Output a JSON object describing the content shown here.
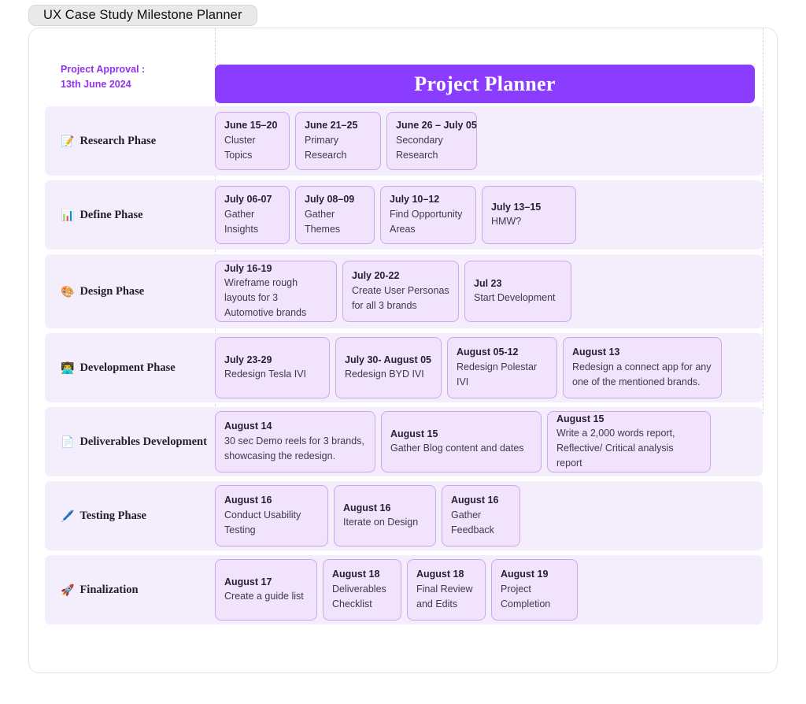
{
  "window": {
    "title": "UX Case Study Milestone Planner"
  },
  "header": {
    "approval_label": "Project Approval :",
    "approval_date": "13th June 2024",
    "banner_title": "Project Planner"
  },
  "colors": {
    "banner_bg": "#8b3dff",
    "accent_purple": "#9333ea",
    "row_bg": "#f4eefc",
    "card_bg": "#f1e3fb",
    "card_border": "#cda6ef",
    "guide_dash": "#dcc6f3"
  },
  "rows": [
    {
      "icon": "memo-icon",
      "icon_glyph": "📝",
      "label": "Research Phase",
      "cards": [
        {
          "date": "June 15–20",
          "desc": "Cluster Topics"
        },
        {
          "date": "June 21–25",
          "desc": "Primary Research"
        },
        {
          "date": "June 26 – July 05",
          "desc": "Secondary Research"
        }
      ]
    },
    {
      "icon": "bar-chart-icon",
      "icon_glyph": "📊",
      "label": "Define  Phase",
      "cards": [
        {
          "date": "July 06-07",
          "desc": "Gather Insights"
        },
        {
          "date": "July 08–09",
          "desc": "Gather Themes"
        },
        {
          "date": "July 10–12",
          "desc": "Find Opportunity Areas"
        },
        {
          "date": "July 13–15",
          "desc": "HMW?"
        }
      ]
    },
    {
      "icon": "palette-icon",
      "icon_glyph": "🎨",
      "label": "Design Phase",
      "cards": [
        {
          "date": "July 16-19",
          "desc": "Wireframe rough layouts for 3 Automotive brands"
        },
        {
          "date": "July 20-22",
          "desc": "Create User Personas for all 3 brands"
        },
        {
          "date": "Jul 23",
          "desc": "Start Development"
        }
      ]
    },
    {
      "icon": "technologist-icon",
      "icon_glyph": "👨‍💻",
      "label": "Development Phase",
      "cards": [
        {
          "date": "July 23-29",
          "desc": "Redesign Tesla IVI"
        },
        {
          "date": "July 30- August 05",
          "desc": "Redesign BYD IVI"
        },
        {
          "date": "August 05-12",
          "desc": "Redesign Polestar IVI"
        },
        {
          "date": "August 13",
          "desc": "Redesign a connect app for any one of the mentioned brands."
        }
      ]
    },
    {
      "icon": "page-document-icon",
      "icon_glyph": "📄",
      "label": "Deliverables Development",
      "cards": [
        {
          "date": "August 14",
          "desc": "30 sec Demo reels for 3 brands, showcasing the redesign."
        },
        {
          "date": "August 15",
          "desc": "Gather Blog content and dates"
        },
        {
          "date": "August 15",
          "desc": "Write a 2,000 words report, Reflective/ Critical analysis report"
        }
      ]
    },
    {
      "icon": "pen-icon",
      "icon_glyph": "🖊️",
      "label": "Testing Phase",
      "cards": [
        {
          "date": "August 16",
          "desc": "Conduct Usability Testing"
        },
        {
          "date": "August 16",
          "desc": "Iterate on Design"
        },
        {
          "date": "August 16",
          "desc": "Gather Feedback"
        }
      ]
    },
    {
      "icon": "rocket-icon",
      "icon_glyph": "🚀",
      "label": "Finalization",
      "cards": [
        {
          "date": "August 17",
          "desc": "Create a guide list"
        },
        {
          "date": "August 18",
          "desc": "Deliverables Checklist"
        },
        {
          "date": "August 18",
          "desc": "Final Review and Edits"
        },
        {
          "date": "August 19",
          "desc": "Project Completion"
        }
      ]
    }
  ]
}
